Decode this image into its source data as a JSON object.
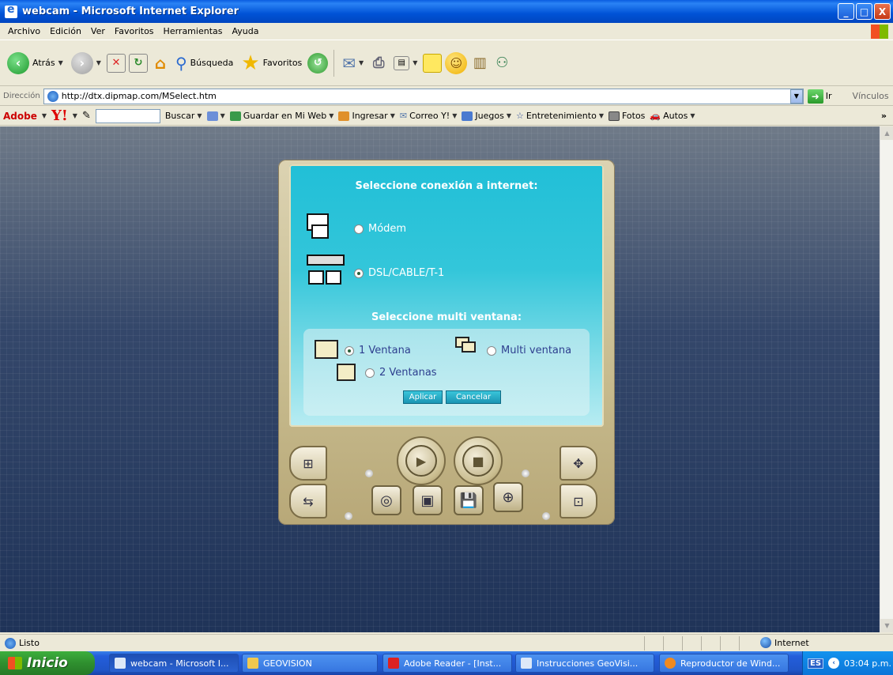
{
  "window": {
    "title": "webcam - Microsoft Internet Explorer",
    "minimize": "_",
    "maximize": "□",
    "close": "X"
  },
  "menu": [
    "Archivo",
    "Edición",
    "Ver",
    "Favoritos",
    "Herramientas",
    "Ayuda"
  ],
  "toolbar": {
    "back": "Atrás",
    "search": "Búsqueda",
    "favorites": "Favoritos"
  },
  "address": {
    "label": "Dirección",
    "url": "http://dtx.dipmap.com/MSelect.htm",
    "go": "Ir",
    "links": "Vínculos"
  },
  "yahoo": {
    "adobe": "Adobe",
    "logo": "Y!",
    "search_btn": "Buscar",
    "items": [
      "Guardar en Mi Web",
      "Ingresar",
      "Correo Y!",
      "Juegos",
      "Entretenimiento",
      "Fotos",
      "Autos"
    ]
  },
  "webcam": {
    "conn_title": "Seleccione conexión a internet:",
    "modem": "Módem",
    "dsl": "DSL/CABLE/T-1",
    "conn_selected": "dsl",
    "multi_title": "Seleccione multi ventana:",
    "one_window": "1 Ventana",
    "two_windows": "2 Ventanas",
    "multi_window": "Multi ventana",
    "window_selected": "one",
    "apply": "Aplicar",
    "cancel": "Cancelar"
  },
  "status": {
    "text": "Listo",
    "zone": "Internet"
  },
  "taskbar": {
    "start": "Inicio",
    "tasks": [
      "webcam - Microsoft I...",
      "GEOVISION",
      "Adobe Reader - [Inst...",
      "Instrucciones GeoVisi...",
      "Reproductor de Wind..."
    ],
    "lang": "ES",
    "clock": "03:04 p.m."
  },
  "colors": {
    "title_blue": "#0052D6",
    "screen_cyan": "#21BFD7",
    "taskbar_blue": "#245EDB",
    "start_green": "#2F8F2F"
  }
}
